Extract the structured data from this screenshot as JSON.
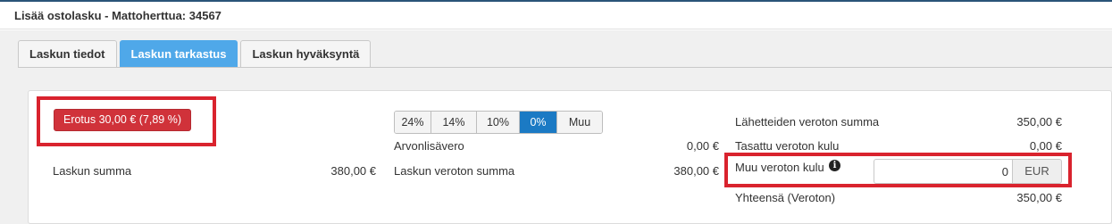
{
  "window": {
    "title": "Lisää ostolasku - Mattoherttua: 34567"
  },
  "tabs": [
    {
      "label": "Laskun tiedot",
      "active": false
    },
    {
      "label": "Laskun tarkastus",
      "active": true
    },
    {
      "label": "Laskun hyväksyntä",
      "active": false
    }
  ],
  "difference": {
    "label": "Erotus 30,00 € (7,89 %)"
  },
  "left": {
    "invoice_sum_label": "Laskun summa",
    "invoice_sum_value": "380,00 €"
  },
  "vat": {
    "options": [
      {
        "label": "24%",
        "active": false
      },
      {
        "label": "14%",
        "active": false
      },
      {
        "label": "10%",
        "active": false
      },
      {
        "label": "0%",
        "active": true
      },
      {
        "label": "Muu",
        "active": false
      }
    ],
    "vat_label": "Arvonlisävero",
    "vat_value": "0,00 €",
    "net_sum_label": "Laskun veroton summa",
    "net_sum_value": "380,00 €"
  },
  "right": {
    "shipments_label": "Lähetteiden veroton summa",
    "shipments_value": "350,00 €",
    "balanced_label": "Tasattu veroton kulu",
    "balanced_value": "0,00 €",
    "other_cost_label": "Muu veroton kulu",
    "other_cost_value": "0",
    "currency": "EUR",
    "total_label": "Yhteensä (Veroton)",
    "total_value": "350,00 €"
  },
  "colors": {
    "accent": "#4fa8e9",
    "active_vat": "#1b7ac4",
    "danger": "#d0323a",
    "highlight": "#d9232e"
  }
}
